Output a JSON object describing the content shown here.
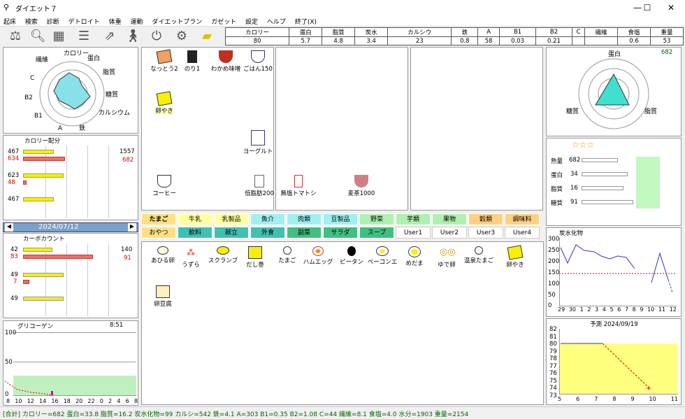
{
  "window": {
    "title": "ダイエット７",
    "min": "—",
    "max": "☐",
    "close": "✕"
  },
  "menu": [
    "起床",
    "検索",
    "診断",
    "デトロイト",
    "体重",
    "運動",
    "ダイエットプラン",
    "ガゼット",
    "設定",
    "ヘルプ",
    "終了(X)"
  ],
  "nutrients": {
    "headers": [
      "カロリー",
      "蛋白",
      "脂質",
      "炭水",
      "カルシウ",
      "鉄",
      "A",
      "B1",
      "B2",
      "C",
      "繊維",
      "食塩",
      "重量"
    ],
    "values": [
      "80",
      "5.7",
      "4.8",
      "3.4",
      "23",
      "0.8",
      "58",
      "0.03",
      "0.21",
      "",
      "",
      "0.6",
      "53"
    ]
  },
  "radar_left": {
    "labels": [
      "カロリー",
      "蛋白",
      "脂質",
      "糖質",
      "カルシウム",
      "鉄",
      "A",
      "B1",
      "B2",
      "C",
      "繊維"
    ]
  },
  "calorie": {
    "title": "カロリー配分",
    "rows": [
      {
        "a": "467",
        "b": "634"
      },
      {
        "a": "623",
        "b": "48"
      },
      {
        "a": "467",
        "b": ""
      }
    ],
    "right_a": "1557",
    "right_b": "682"
  },
  "date_nav": {
    "date": "2024/07/12",
    "prev": "◀",
    "next": "▶"
  },
  "carb": {
    "title": "カーボカウント",
    "rows": [
      {
        "a": "42",
        "b": "83"
      },
      {
        "a": "49",
        "b": "7"
      },
      {
        "a": "49",
        "b": ""
      }
    ],
    "right_a": "140",
    "right_b": "91"
  },
  "glycogen": {
    "title": "グリコーゲン",
    "time": "8:51",
    "yticks": [
      "100",
      "50",
      "0"
    ],
    "xticks": [
      "8",
      "10",
      "12",
      "14",
      "16",
      "18",
      "20",
      "22",
      "0",
      "2",
      "4",
      "6",
      "8"
    ]
  },
  "meal_items": [
    {
      "label": "なっとう2"
    },
    {
      "label": "のり1"
    },
    {
      "label": "わかめ味噌"
    },
    {
      "label": "ごはん150"
    },
    {
      "label": "卵やき"
    }
  ],
  "panel_items": [
    {
      "label": "ヨーグルト"
    },
    {
      "label": "低脂肪200"
    },
    {
      "label": "コーヒー"
    },
    {
      "label": "無塩トマトシ"
    },
    {
      "label": "麦茶1000"
    }
  ],
  "categories": [
    [
      "たまご",
      "牛乳",
      "乳製品",
      "魚介",
      "肉類",
      "豆製品",
      "野菜",
      "芋類",
      "果物",
      "穀類",
      "調味料"
    ],
    [
      "おやつ",
      "飲料",
      "献立",
      "外食",
      "副菜",
      "サラダ",
      "スープ",
      "User1",
      "User2",
      "User3",
      "User4"
    ]
  ],
  "foods": [
    "あひる卵",
    "うずら",
    "スクランブ",
    "だし巻",
    "たまご",
    "ハムエッグ",
    "ピータン",
    "ベーコンエ",
    "めだま",
    "ゆで卵",
    "温泉たまご",
    "卵やき",
    "卵豆腐"
  ],
  "radar_right": {
    "value": "682",
    "labels": [
      "蛋白",
      "脂質",
      "糖質"
    ]
  },
  "score": {
    "stars": "☆☆☆",
    "rows": [
      {
        "label": "熱量",
        "value": "682"
      },
      {
        "label": "蛋白",
        "value": "34"
      },
      {
        "label": "脂質",
        "value": "16"
      },
      {
        "label": "糖質",
        "value": "91"
      }
    ]
  },
  "carb_chart": {
    "title": "炭水化物",
    "yticks": [
      "300",
      "250",
      "200",
      "150",
      "100",
      "50",
      "0"
    ],
    "xticks": [
      "29",
      "30",
      "1",
      "2",
      "3",
      "4",
      "5",
      "6",
      "7",
      "8",
      "9",
      "10",
      "11",
      "12"
    ]
  },
  "forecast": {
    "title": "予測 2024/09/19",
    "yticks": [
      "82",
      "81",
      "80",
      "79",
      "78",
      "77",
      "76",
      "75",
      "74",
      "73"
    ],
    "xticks": [
      "5",
      "6",
      "7",
      "8",
      "9",
      "10",
      "11"
    ]
  },
  "status": "[合計] カロリー=682 蛋白=33.8 脂質=16.2 炭水化物=99 カルシ=542 鉄=4.1 A=303 B1=0.35 B2=1.08 C=44 繊維=8.1 食塩=4.0 水分=1903 重量=2154",
  "colors": {
    "yellow": "#f8f000",
    "red": "#f07060",
    "cyan": "#88e0e8",
    "green": "#c0f0c0"
  }
}
